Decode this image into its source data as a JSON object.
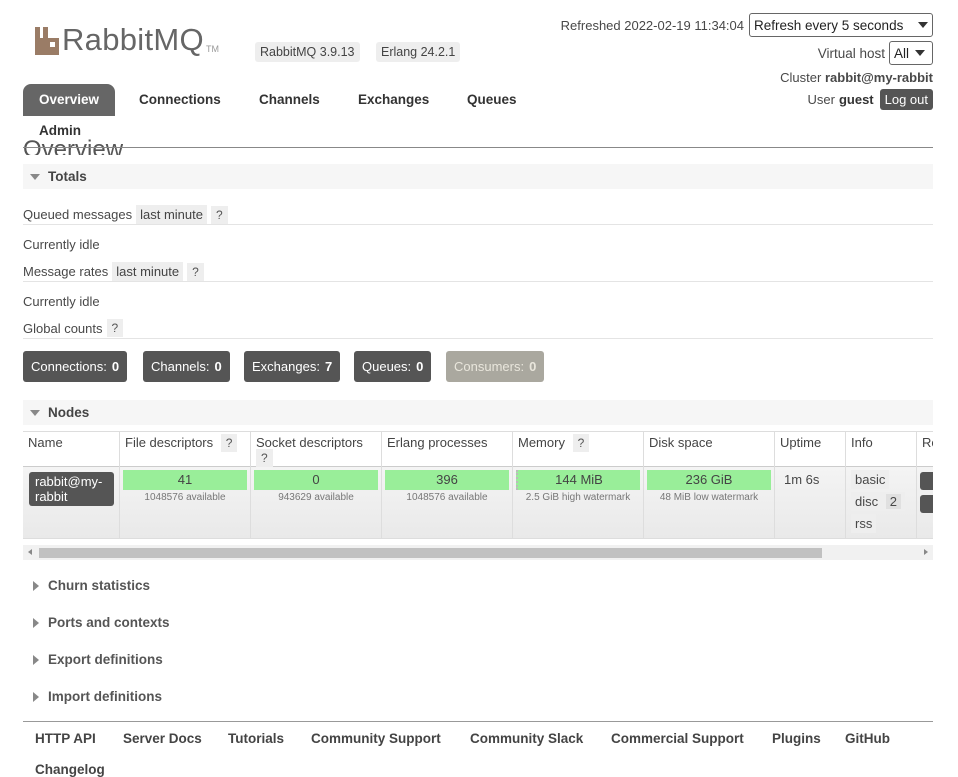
{
  "header": {
    "logo_text": "RabbitMQ",
    "logo_tm": "TM",
    "rabbitmq_version": "RabbitMQ 3.9.13",
    "erlang_version": "Erlang 24.2.1",
    "refreshed": "Refreshed 2022-02-19 11:34:04",
    "refresh_option": "Refresh every 5 seconds",
    "vhost_label": "Virtual host",
    "vhost_option": "All",
    "cluster_label": "Cluster",
    "cluster_name": "rabbit@my-rabbit",
    "user_label": "User",
    "user_name": "guest",
    "logout_label": "Log out"
  },
  "tabs": [
    {
      "label": "Overview",
      "active": true
    },
    {
      "label": "Connections"
    },
    {
      "label": "Channels"
    },
    {
      "label": "Exchanges"
    },
    {
      "label": "Queues"
    },
    {
      "label": "Admin"
    }
  ],
  "page_title": "Overview",
  "totals": {
    "title": "Totals",
    "queued_label": "Queued messages",
    "queued_range": "last minute",
    "queued_status": "Currently idle",
    "rates_label": "Message rates",
    "rates_range": "last minute",
    "rates_status": "Currently idle",
    "global_label": "Global counts",
    "help": "?"
  },
  "counts": [
    {
      "label": "Connections:",
      "value": "0"
    },
    {
      "label": "Channels:",
      "value": "0"
    },
    {
      "label": "Exchanges:",
      "value": "7"
    },
    {
      "label": "Queues:",
      "value": "0"
    },
    {
      "label": "Consumers:",
      "value": "0"
    }
  ],
  "nodes": {
    "title": "Nodes",
    "columns": [
      "Name",
      "File descriptors",
      "Socket descriptors",
      "Erlang processes",
      "Memory",
      "Disk space",
      "Uptime",
      "Info",
      "Re"
    ],
    "row": {
      "name": "rabbit@my-rabbit",
      "file_descriptors": "41",
      "file_descriptors_sub": "1048576 available",
      "socket_descriptors": "0",
      "socket_descriptors_sub": "943629 available",
      "erlang_processes": "396",
      "erlang_processes_sub": "1048576 available",
      "memory": "144 MiB",
      "memory_sub": "2.5 GiB high watermark",
      "disk": "236 GiB",
      "disk_sub": "48 MiB low watermark",
      "uptime": "1m 6s",
      "info_basic": "basic",
      "info_disc": "disc",
      "info_disc_count": "2",
      "info_rss": "rss"
    }
  },
  "collapsed_sections": [
    "Churn statistics",
    "Ports and contexts",
    "Export definitions",
    "Import definitions"
  ],
  "footer": [
    "HTTP API",
    "Server Docs",
    "Tutorials",
    "Community Support",
    "Community Slack",
    "Commercial Support",
    "Plugins",
    "GitHub",
    "Changelog"
  ],
  "colors": {
    "bar_ok": "#99ee99",
    "tab_active": "#666666",
    "button_dark": "#555555"
  }
}
